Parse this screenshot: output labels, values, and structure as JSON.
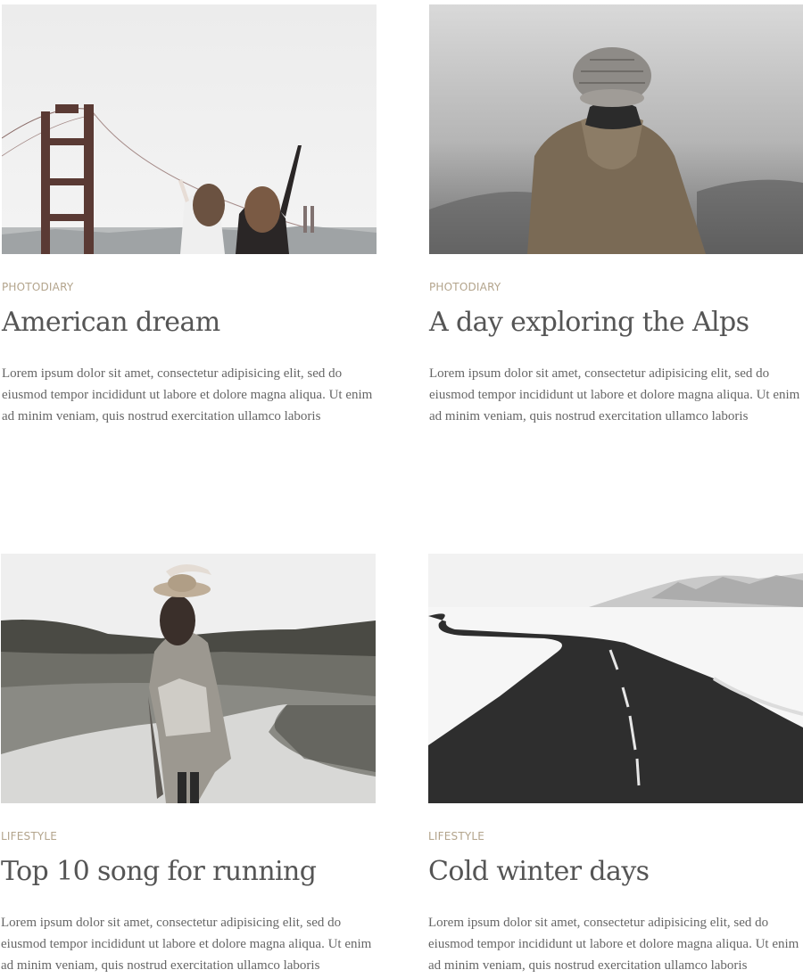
{
  "posts": [
    {
      "category": "PHOTODIARY",
      "title": "American dream",
      "excerpt": "Lorem ipsum dolor sit amet, consectetur adipisicing elit, sed do eiusmod tempor incididunt ut labore et dolore magna aliqua. Ut enim ad minim veniam, quis nostrud exercitation ullamco laboris"
    },
    {
      "category": "PHOTODIARY",
      "title": "A day exploring the Alps",
      "excerpt": "Lorem ipsum dolor sit amet, consectetur adipisicing elit, sed do eiusmod tempor incididunt ut labore et dolore magna aliqua. Ut enim ad minim veniam, quis nostrud exercitation ullamco laboris"
    },
    {
      "category": "LIFESTYLE",
      "title": "Top 10 song for running",
      "excerpt": "Lorem ipsum dolor sit amet, consectetur adipisicing elit, sed do eiusmod tempor incididunt ut labore et dolore magna aliqua. Ut enim ad minim veniam, quis nostrud exercitation ullamco laboris"
    },
    {
      "category": "LIFESTYLE",
      "title": "Cold winter days",
      "excerpt": "Lorem ipsum dolor sit amet, consectetur adipisicing elit, sed do eiusmod tempor incididunt ut labore et dolore magna aliqua. Ut enim ad minim veniam, quis nostrud exercitation ullamco laboris"
    }
  ],
  "colors": {
    "category": "#b3a48c",
    "title": "#555555",
    "excerpt": "#666666",
    "background": "#ffffff"
  }
}
